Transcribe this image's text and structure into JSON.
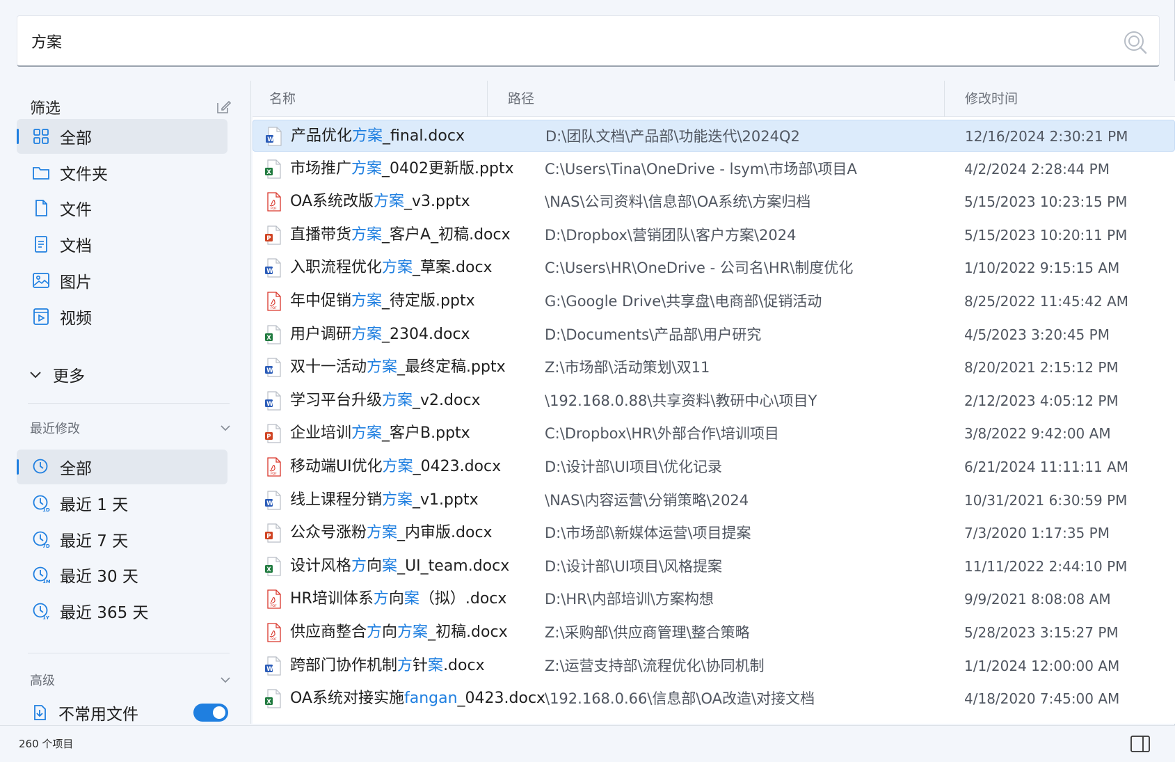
{
  "search": {
    "value": "方案"
  },
  "sidebar": {
    "filter_title": "筛选",
    "type_items": [
      {
        "label": "全部",
        "icon": "grid-icon",
        "active": true
      },
      {
        "label": "文件夹",
        "icon": "folder-icon",
        "active": false
      },
      {
        "label": "文件",
        "icon": "file-icon",
        "active": false
      },
      {
        "label": "文档",
        "icon": "document-icon",
        "active": false
      },
      {
        "label": "图片",
        "icon": "image-icon",
        "active": false
      },
      {
        "label": "视频",
        "icon": "video-icon",
        "active": false
      }
    ],
    "more_label": "更多",
    "recent_title": "最近修改",
    "recent_items": [
      {
        "label": "全部",
        "icon": "clock-icon",
        "active": true
      },
      {
        "label": "最近 1 天",
        "icon": "clock-1d-icon",
        "badge": "1D",
        "active": false
      },
      {
        "label": "最近 7 天",
        "icon": "clock-7d-icon",
        "badge": "7D",
        "active": false
      },
      {
        "label": "最近 30 天",
        "icon": "clock-1m-icon",
        "badge": "1M",
        "active": false
      },
      {
        "label": "最近 365 天",
        "icon": "clock-1y-icon",
        "badge": "1Y",
        "active": false
      }
    ],
    "advanced_title": "高级",
    "advanced_item": {
      "label": "不常用文件",
      "toggle_on": true
    }
  },
  "table": {
    "columns": [
      "名称",
      "路径",
      "修改时间"
    ],
    "rows": [
      {
        "parts": [
          [
            "产品优化",
            false
          ],
          [
            "方案",
            true
          ],
          [
            "_final.docx",
            false
          ]
        ],
        "type": "word",
        "path": "D:\\团队文档\\产品部\\功能迭代\\2024Q2",
        "time": "12/16/2024 2:30:21 PM",
        "selected": true
      },
      {
        "parts": [
          [
            "市场推广",
            false
          ],
          [
            "方案",
            true
          ],
          [
            "_0402更新版.pptx",
            false
          ]
        ],
        "type": "excel",
        "path": "C:\\Users\\Tina\\OneDrive - lsym\\市场部\\项目A",
        "time": "4/2/2024 2:28:44 PM"
      },
      {
        "parts": [
          [
            "OA系统改版",
            false
          ],
          [
            "方案",
            true
          ],
          [
            "_v3.pptx",
            false
          ]
        ],
        "type": "pdf",
        "path": "\\NAS\\公司资料\\信息部\\OA系统\\方案归档",
        "time": "5/15/2023 10:23:15 PM"
      },
      {
        "parts": [
          [
            "直播带货",
            false
          ],
          [
            "方案",
            true
          ],
          [
            "_客户A_初稿.docx",
            false
          ]
        ],
        "type": "ppt",
        "path": "D:\\Dropbox\\营销团队\\客户方案\\2024",
        "time": "5/15/2023 10:20:11 PM"
      },
      {
        "parts": [
          [
            "入职流程优化",
            false
          ],
          [
            "方案",
            true
          ],
          [
            "_草案.docx",
            false
          ]
        ],
        "type": "word",
        "path": "C:\\Users\\HR\\OneDrive - 公司名\\HR\\制度优化",
        "time": "1/10/2022 9:15:15 AM"
      },
      {
        "parts": [
          [
            "年中促销",
            false
          ],
          [
            "方案",
            true
          ],
          [
            "_待定版.pptx",
            false
          ]
        ],
        "type": "pdf",
        "path": "G:\\Google Drive\\共享盘\\电商部\\促销活动",
        "time": "8/25/2022 11:45:42 AM"
      },
      {
        "parts": [
          [
            "用户调研",
            false
          ],
          [
            "方案",
            true
          ],
          [
            "_2304.docx",
            false
          ]
        ],
        "type": "excel",
        "path": "D:\\Documents\\产品部\\用户研究",
        "time": "4/5/2023 3:20:45 PM"
      },
      {
        "parts": [
          [
            "双十一活动",
            false
          ],
          [
            "方案",
            true
          ],
          [
            "_最终定稿.pptx",
            false
          ]
        ],
        "type": "word",
        "path": "Z:\\市场部\\活动策划\\双11",
        "time": "8/20/2021 2:15:12 PM"
      },
      {
        "parts": [
          [
            "学习平台升级",
            false
          ],
          [
            "方案",
            true
          ],
          [
            "_v2.docx",
            false
          ]
        ],
        "type": "word",
        "path": "\\192.168.0.88\\共享资料\\教研中心\\项目Y",
        "time": "2/12/2023 4:05:12 PM"
      },
      {
        "parts": [
          [
            "企业培训",
            false
          ],
          [
            "方案",
            true
          ],
          [
            "_客户B.pptx",
            false
          ]
        ],
        "type": "ppt",
        "path": "C:\\Dropbox\\HR\\外部合作\\培训项目",
        "time": "3/8/2022 9:42:00 AM"
      },
      {
        "parts": [
          [
            "移动端UI优化",
            false
          ],
          [
            "方案",
            true
          ],
          [
            "_0423.docx",
            false
          ]
        ],
        "type": "pdf",
        "path": "D:\\设计部\\UI项目\\优化记录",
        "time": "6/21/2024 11:11:11 AM"
      },
      {
        "parts": [
          [
            "线上课程分销",
            false
          ],
          [
            "方案",
            true
          ],
          [
            "_v1.pptx",
            false
          ]
        ],
        "type": "word",
        "path": "\\NAS\\内容运营\\分销策略\\2024",
        "time": "10/31/2021 6:30:59 PM"
      },
      {
        "parts": [
          [
            "公众号涨粉",
            false
          ],
          [
            "方案",
            true
          ],
          [
            "_内审版.docx",
            false
          ]
        ],
        "type": "ppt",
        "path": "D:\\市场部\\新媒体运营\\项目提案",
        "time": "7/3/2020 1:17:35 PM"
      },
      {
        "parts": [
          [
            "设计风格",
            false
          ],
          [
            "方",
            true
          ],
          [
            "向",
            false
          ],
          [
            "案",
            true
          ],
          [
            "_UI_team.docx",
            false
          ]
        ],
        "type": "excel",
        "path": "D:\\设计部\\UI项目\\风格提案",
        "time": "11/11/2022 2:44:10 PM"
      },
      {
        "parts": [
          [
            "HR培训体系",
            false
          ],
          [
            "方",
            true
          ],
          [
            "向",
            false
          ],
          [
            "案",
            true
          ],
          [
            "（拟）.docx",
            false
          ]
        ],
        "type": "pdf",
        "path": "D:\\HR\\内部培训\\方案构想",
        "time": "9/9/2021 8:08:08 AM"
      },
      {
        "parts": [
          [
            "供应商整合",
            false
          ],
          [
            "方",
            true
          ],
          [
            "向",
            false
          ],
          [
            "方案",
            true
          ],
          [
            "_初稿.docx",
            false
          ]
        ],
        "type": "pdf",
        "path": "Z:\\采购部\\供应商管理\\整合策略",
        "time": "5/28/2023 3:15:27 PM"
      },
      {
        "parts": [
          [
            "跨部门协作机制",
            false
          ],
          [
            "方",
            true
          ],
          [
            "针",
            false
          ],
          [
            "案",
            true
          ],
          [
            ".docx",
            false
          ]
        ],
        "type": "word",
        "path": "Z:\\运营支持部\\流程优化\\协同机制",
        "time": "1/1/2024 12:00:00 AM"
      },
      {
        "parts": [
          [
            "OA系统对接实施",
            false
          ],
          [
            "fangan",
            true
          ],
          [
            "_0423.docx",
            false
          ]
        ],
        "type": "excel",
        "path": "\\192.168.0.66\\信息部\\OA改造\\对接文档",
        "time": "4/18/2020 7:45:00 AM"
      }
    ]
  },
  "status": {
    "count": "260 个项目"
  },
  "colors": {
    "accent": "#1f7fe0",
    "selected_row": "#dcebfb",
    "word": "#2b5cb8",
    "excel": "#1f7a3e",
    "ppt": "#d04423",
    "pdf": "#d9362b"
  }
}
